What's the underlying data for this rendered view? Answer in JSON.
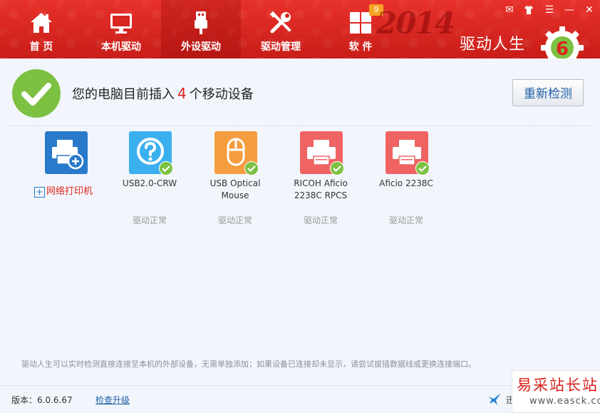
{
  "nav": [
    {
      "label": "首 页",
      "icon": "home-icon"
    },
    {
      "label": "本机驱动",
      "icon": "monitor-icon"
    },
    {
      "label": "外设驱动",
      "icon": "usb-icon",
      "active": true
    },
    {
      "label": "驱动管理",
      "icon": "tools-icon"
    },
    {
      "label": "软 件",
      "icon": "grid-icon",
      "badge": "9"
    }
  ],
  "header": {
    "brand": "驱动人生",
    "year_art": "2014",
    "logo_digit": "6"
  },
  "window_controls": [
    {
      "icon": "message-icon",
      "glyph": "✉"
    },
    {
      "icon": "shirt-icon",
      "glyph": "👕"
    },
    {
      "icon": "menu-icon",
      "glyph": "☰"
    },
    {
      "icon": "minimize-icon",
      "glyph": "—"
    },
    {
      "icon": "close-icon",
      "glyph": "✕"
    }
  ],
  "status": {
    "prefix": "您的电脑目前插入",
    "count": "4",
    "suffix": "个移动设备",
    "rescan_label": "重新检测"
  },
  "add_printer": {
    "label": "网络打印机",
    "plus": "+"
  },
  "devices": [
    {
      "name_line1": "USB2.0-CRW",
      "name_line2": "",
      "status": "驱动正常",
      "color": "#3cb0ef",
      "icon": "question-icon"
    },
    {
      "name_line1": "USB Optical",
      "name_line2": "Mouse",
      "status": "驱动正常",
      "color": "#f59c3f",
      "icon": "mouse-icon"
    },
    {
      "name_line1": "RICOH Aficio",
      "name_line2": "2238C RPCS",
      "status": "驱动正常",
      "color": "#ef6363",
      "icon": "printer-icon"
    },
    {
      "name_line1": "Aficio 2238C",
      "name_line2": "",
      "status": "驱动正常",
      "color": "#ef6363",
      "icon": "printer-icon"
    }
  ],
  "tip": "驱动人生可以实时检测直接连接至本机的外部设备，无需单独添加；如果设备已连接却未显示，请尝试拔插数据线或更换连接端口。",
  "footer": {
    "version": "版本：6.0.6.67",
    "upgrade": "检查升级",
    "thunder_text": "迅"
  },
  "watermark": {
    "title": "易采站长站",
    "url": "www.easck.com"
  },
  "colors": {
    "header_red": "#d9251f",
    "accent_green": "#7dc142",
    "count_red": "#e0241c",
    "link_blue": "#1e5ea8"
  }
}
